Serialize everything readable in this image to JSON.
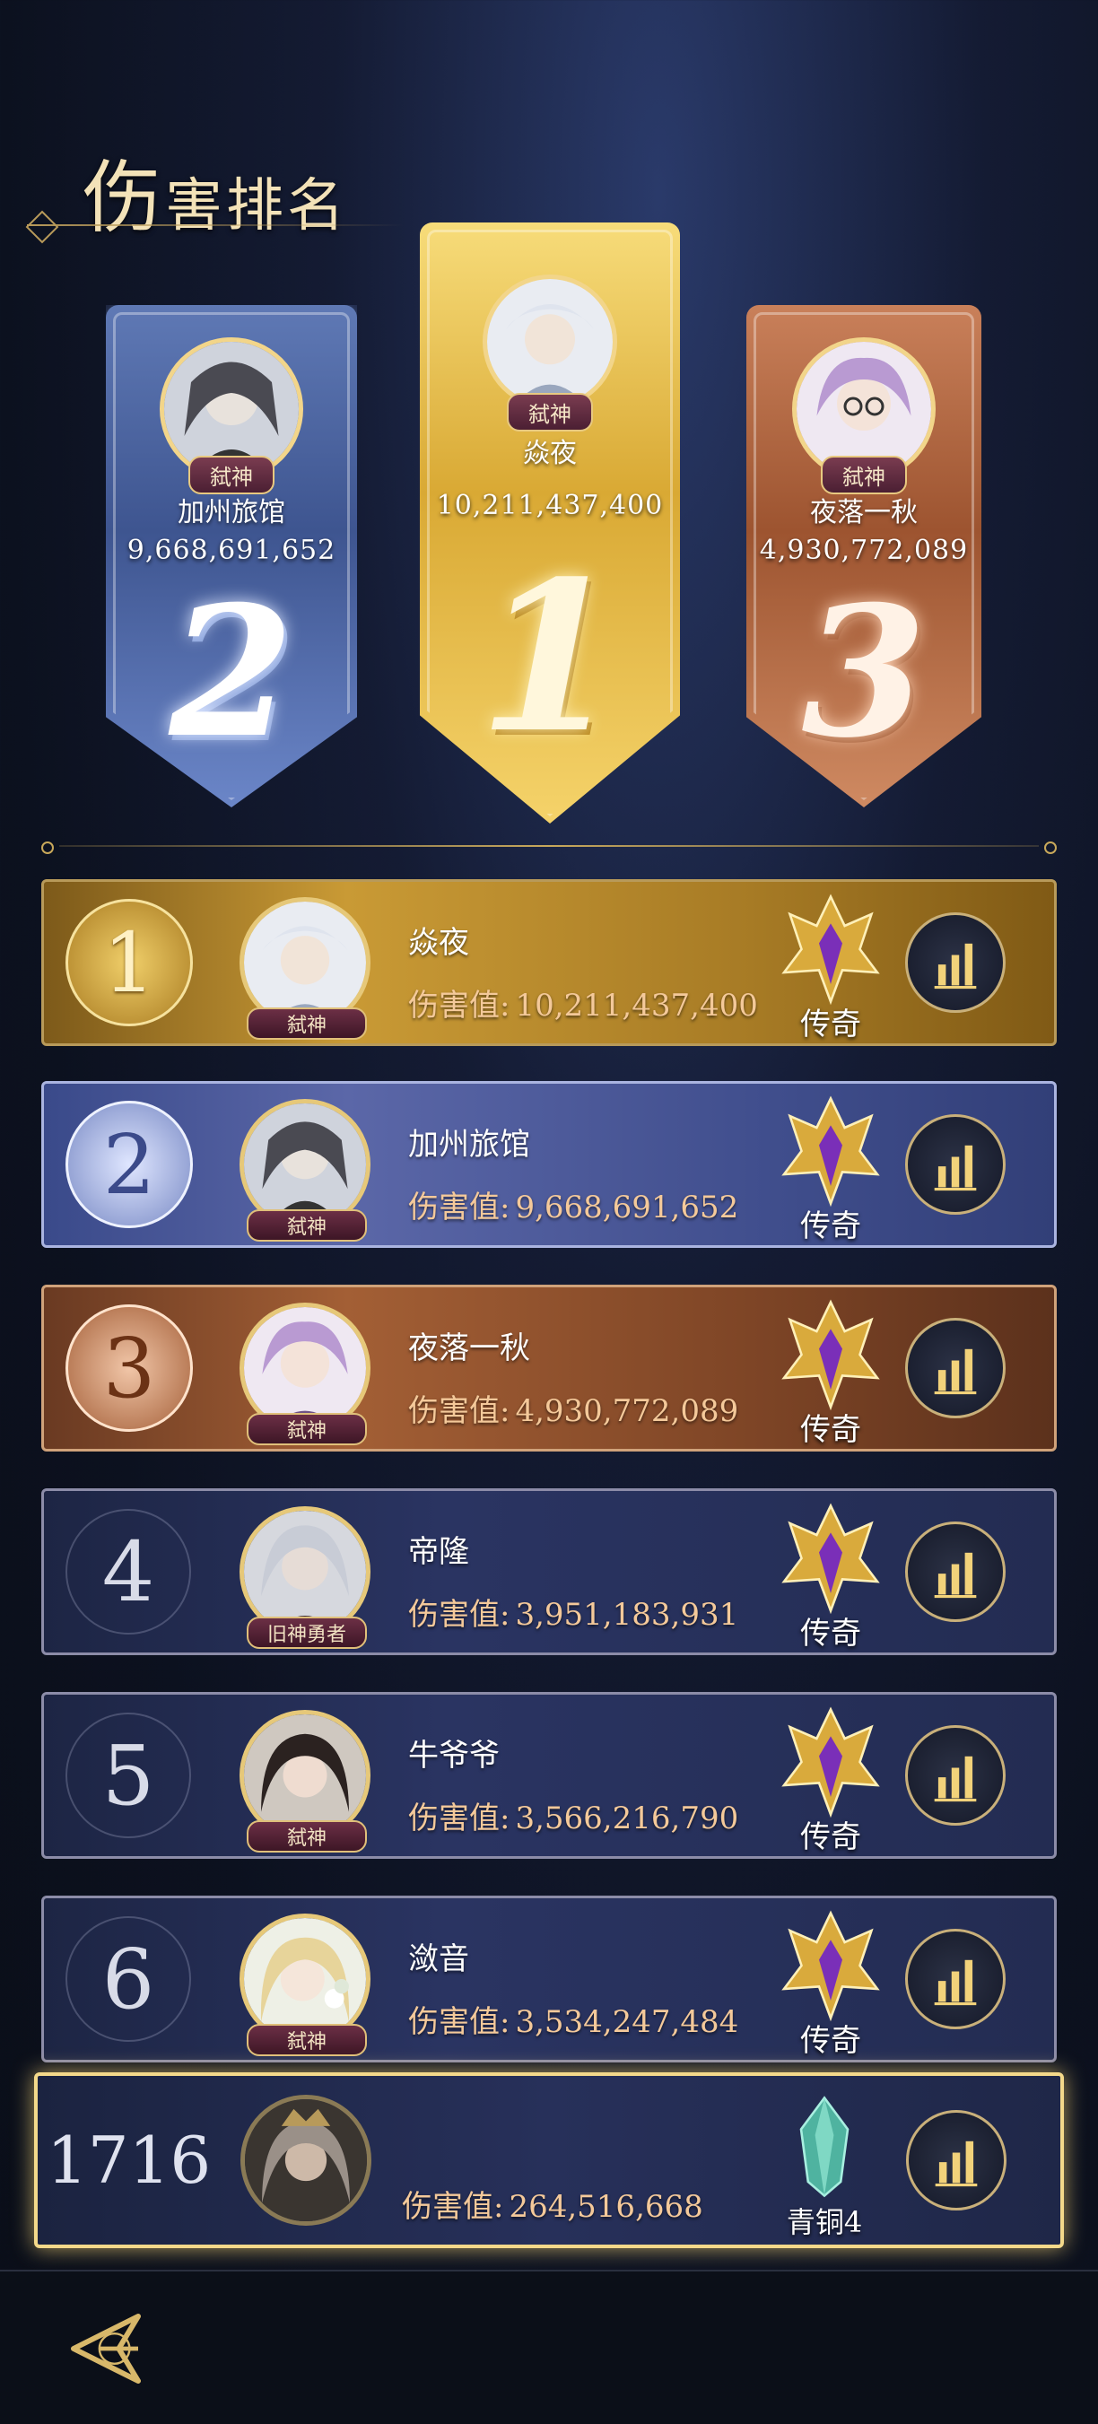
{
  "header": {
    "title_first": "伤",
    "title_rest": "害排名"
  },
  "podium": [
    {
      "rank": "2",
      "name": "加州旅馆",
      "score": "9,668,691,652",
      "badge": "弑神"
    },
    {
      "rank": "1",
      "name": "焱夜",
      "score": "10,211,437,400",
      "badge": "弑神"
    },
    {
      "rank": "3",
      "name": "夜落一秋",
      "score": "4,930,772,089",
      "badge": "弑神"
    }
  ],
  "rows": [
    {
      "rank": "1",
      "name": "焱夜",
      "damage_label": "伤害值:",
      "damage": "10,211,437,400",
      "badge": "弑神",
      "tier": "传奇"
    },
    {
      "rank": "2",
      "name": "加州旅馆",
      "damage_label": "伤害值:",
      "damage": "9,668,691,652",
      "badge": "弑神",
      "tier": "传奇"
    },
    {
      "rank": "3",
      "name": "夜落一秋",
      "damage_label": "伤害值:",
      "damage": "4,930,772,089",
      "badge": "弑神",
      "tier": "传奇"
    },
    {
      "rank": "4",
      "name": "帝隆",
      "damage_label": "伤害值:",
      "damage": "3,951,183,931",
      "badge": "旧神勇者",
      "tier": "传奇"
    },
    {
      "rank": "5",
      "name": "牛爷爷",
      "damage_label": "伤害值:",
      "damage": "3,566,216,790",
      "badge": "弑神",
      "tier": "传奇"
    },
    {
      "rank": "6",
      "name": "潋音",
      "damage_label": "伤害值:",
      "damage": "3,534,247,484",
      "badge": "弑神",
      "tier": "传奇"
    }
  ],
  "my_row": {
    "rank": "1716",
    "damage_label": "伤害值:",
    "damage": "264,516,668",
    "tier": "青铜4"
  },
  "colors": {
    "gold": "#c99a35",
    "silver": "#5b67a8",
    "bronze": "#a35f35",
    "accent": "#f4d98a"
  },
  "icons": {
    "stats": "bar-chart-icon",
    "tier_legend": "legend-crest-icon",
    "tier_bronze": "bronze-crystal-icon",
    "back": "back-arrow-icon"
  }
}
